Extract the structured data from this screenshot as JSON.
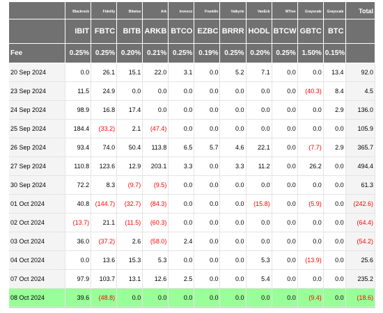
{
  "columns": [
    {
      "issuer": "Blackrock",
      "ticker": "IBIT",
      "fee": "0.25%"
    },
    {
      "issuer": "Fidelity",
      "ticker": "FBTC",
      "fee": "0.25%"
    },
    {
      "issuer": "Bitwise",
      "ticker": "BITB",
      "fee": "0.20%"
    },
    {
      "issuer": "Ark",
      "ticker": "ARKB",
      "fee": "0.21%"
    },
    {
      "issuer": "Invesco",
      "ticker": "BTCO",
      "fee": "0.25%"
    },
    {
      "issuer": "Franklin",
      "ticker": "EZBC",
      "fee": "0.19%"
    },
    {
      "issuer": "Valkyrie",
      "ticker": "BRRR",
      "fee": "0.25%"
    },
    {
      "issuer": "VanEck",
      "ticker": "HODL",
      "fee": "0.20%"
    },
    {
      "issuer": "WTree",
      "ticker": "BTCW",
      "fee": "0.25%"
    },
    {
      "issuer": "Grayscale",
      "ticker": "GBTC",
      "fee": "1.50%"
    },
    {
      "issuer": "Grayscale",
      "ticker": "BTC",
      "fee": "0.15%"
    }
  ],
  "total_label": "Total",
  "fee_label": "Fee",
  "rows": [
    {
      "date": "20 Sep 2024",
      "values": [
        "0.0",
        "26.1",
        "15.1",
        "22.0",
        "3.1",
        "0.0",
        "5.2",
        "7.1",
        "0.0",
        "0.0",
        "13.4"
      ],
      "total": "92.0"
    },
    {
      "date": "23 Sep 2024",
      "values": [
        "11.5",
        "24.9",
        "0.0",
        "0.0",
        "0.0",
        "0.0",
        "0.0",
        "0.0",
        "0.0",
        "(40.3)",
        "8.4"
      ],
      "total": "4.5"
    },
    {
      "date": "24 Sep 2024",
      "values": [
        "98.9",
        "16.8",
        "17.4",
        "0.0",
        "0.0",
        "0.0",
        "0.0",
        "0.0",
        "0.0",
        "0.0",
        "2.9"
      ],
      "total": "136.0"
    },
    {
      "date": "25 Sep 2024",
      "values": [
        "184.4",
        "(33.2)",
        "2.1",
        "(47.4)",
        "0.0",
        "0.0",
        "0.0",
        "0.0",
        "0.0",
        "0.0",
        "0.0"
      ],
      "total": "105.9"
    },
    {
      "date": "26 Sep 2024",
      "values": [
        "93.4",
        "74.0",
        "50.4",
        "113.8",
        "6.5",
        "5.7",
        "4.6",
        "22.1",
        "0.0",
        "(7.7)",
        "2.9"
      ],
      "total": "365.7"
    },
    {
      "date": "27 Sep 2024",
      "values": [
        "110.8",
        "123.6",
        "12.9",
        "203.1",
        "3.3",
        "0.0",
        "3.3",
        "11.2",
        "0.0",
        "26.2",
        "0.0"
      ],
      "total": "494.4"
    },
    {
      "date": "30 Sep 2024",
      "values": [
        "72.2",
        "8.3",
        "(9.7)",
        "(9.5)",
        "0.0",
        "0.0",
        "0.0",
        "0.0",
        "0.0",
        "0.0",
        "0.0"
      ],
      "total": "61.3"
    },
    {
      "date": "01 Oct 2024",
      "values": [
        "40.8",
        "(144.7)",
        "(32.7)",
        "(84.3)",
        "0.0",
        "0.0",
        "0.0",
        "(15.8)",
        "0.0",
        "(5.9)",
        "0.0"
      ],
      "total": "(242.6)"
    },
    {
      "date": "02 Oct 2024",
      "values": [
        "(13.7)",
        "21.1",
        "(11.5)",
        "(60.3)",
        "0.0",
        "0.0",
        "0.0",
        "0.0",
        "0.0",
        "0.0",
        "0.0"
      ],
      "total": "(64.4)"
    },
    {
      "date": "03 Oct 2024",
      "values": [
        "36.0",
        "(37.2)",
        "2.6",
        "(58.0)",
        "2.4",
        "0.0",
        "0.0",
        "0.0",
        "0.0",
        "0.0",
        "0.0"
      ],
      "total": "(54.2)"
    },
    {
      "date": "04 Oct 2024",
      "values": [
        "0.0",
        "13.6",
        "15.3",
        "5.3",
        "0.0",
        "0.0",
        "0.0",
        "5.3",
        "0.0",
        "(13.9)",
        "0.0"
      ],
      "total": "25.6"
    },
    {
      "date": "07 Oct 2024",
      "values": [
        "97.9",
        "103.7",
        "13.1",
        "12.6",
        "2.5",
        "0.0",
        "0.0",
        "5.4",
        "0.0",
        "0.0",
        "0.0"
      ],
      "total": "235.2"
    },
    {
      "date": "08 Oct 2024",
      "values": [
        "39.6",
        "(48.8)",
        "0.0",
        "0.0",
        "0.0",
        "0.0",
        "0.0",
        "0.0",
        "0.0",
        "(9.4)",
        "0.0"
      ],
      "total": "(18.6)",
      "highlight": true
    }
  ],
  "colors": {
    "header_bg": "#717171",
    "negative": "#ff0000",
    "highlight_row": "#99ff99",
    "date_cell_bg": "#f4f4f4"
  }
}
